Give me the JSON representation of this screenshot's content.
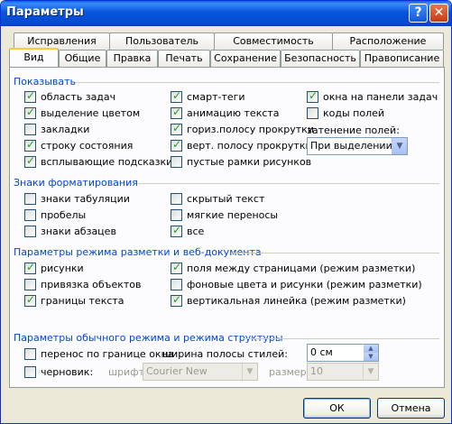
{
  "window": {
    "title": "Параметры",
    "help_label": "?",
    "close_label": "✕"
  },
  "tabs_row1": [
    "Исправления",
    "Пользователь",
    "Совместимость",
    "Расположение"
  ],
  "tabs_row2": [
    "Вид",
    "Общие",
    "Правка",
    "Печать",
    "Сохранение",
    "Безопасность",
    "Правописание"
  ],
  "groups": {
    "show": "Показывать",
    "format_marks": "Знаки форматирования",
    "layout": "Параметры режима разметки и веб-документа",
    "normal": "Параметры обычного режима и режима структуры"
  },
  "show": {
    "c1": [
      {
        "label": "область задач",
        "checked": true
      },
      {
        "label": "выделение цветом",
        "checked": true
      },
      {
        "label": "закладки",
        "checked": false
      },
      {
        "label": "строку состояния",
        "checked": true
      },
      {
        "label": "всплывающие подсказки",
        "checked": true
      }
    ],
    "c2": [
      {
        "label": "смарт-теги",
        "checked": true
      },
      {
        "label": "анимацию текста",
        "checked": true
      },
      {
        "label": "гориз.полосу прокрутки",
        "checked": true
      },
      {
        "label": "верт. полосу прокрутки",
        "checked": true
      },
      {
        "label": "пустые рамки рисунков",
        "checked": false
      }
    ],
    "c3": [
      {
        "label": "окна на панели задач",
        "checked": true
      },
      {
        "label": "коды полей",
        "checked": false
      }
    ],
    "field_shading_label": "затенение полей:",
    "field_shading_value": "При выделении"
  },
  "format_marks": {
    "c1": [
      {
        "label": "знаки табуляции",
        "checked": false
      },
      {
        "label": "пробелы",
        "checked": false
      },
      {
        "label": "знаки абзацев",
        "checked": false
      }
    ],
    "c2": [
      {
        "label": "скрытый текст",
        "checked": false
      },
      {
        "label": "мягкие переносы",
        "checked": false
      },
      {
        "label": "все",
        "checked": true
      }
    ]
  },
  "layout": {
    "c1": [
      {
        "label": "рисунки",
        "checked": true
      },
      {
        "label": "привязка объектов",
        "checked": false
      },
      {
        "label": "границы текста",
        "checked": true
      }
    ],
    "c2": [
      {
        "label": "поля между страницами (режим разметки)",
        "checked": true
      },
      {
        "label": "фоновые цвета и рисунки (режим разметки)",
        "checked": false
      },
      {
        "label": "вертикальная линейка (режим разметки)",
        "checked": true
      }
    ]
  },
  "normal": {
    "wrap_label": "перенос по границе окна",
    "wrap_checked": false,
    "draft_label": "черновик:",
    "draft_checked": false,
    "style_width_label": "ширина полосы стилей:",
    "style_width_value": "0 см",
    "font_label": "шрифт:",
    "font_value": "Courier New",
    "size_label": "размер:",
    "size_value": "10"
  },
  "buttons": {
    "ok": "ОК",
    "cancel": "Отмена"
  }
}
